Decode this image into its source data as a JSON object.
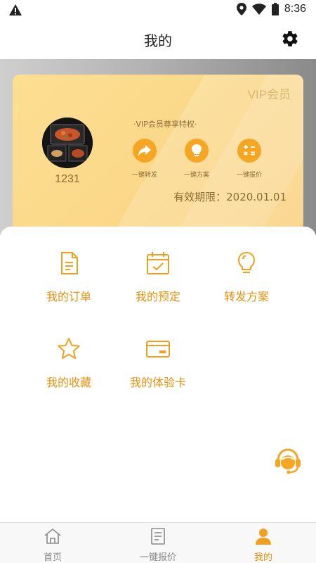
{
  "status_bar": {
    "time": "8:36"
  },
  "header": {
    "title": "我的"
  },
  "vip_card": {
    "badge": "VIP会员",
    "username": "1231",
    "perks_title": "·VIP会员尊享特权·",
    "perks": [
      {
        "label": "一键转发",
        "icon": "share-arrow-icon"
      },
      {
        "label": "一键方案",
        "icon": "lightbulb-icon"
      },
      {
        "label": "一键报价",
        "icon": "calculator-icon"
      }
    ],
    "expiry": "有效期限：2020.01.01"
  },
  "menu": [
    {
      "label": "我的订单",
      "icon": "order-document-icon"
    },
    {
      "label": "我的预定",
      "icon": "calendar-check-icon"
    },
    {
      "label": "转发方案",
      "icon": "lightbulb-icon"
    },
    {
      "label": "我的收藏",
      "icon": "star-icon"
    },
    {
      "label": "我的体验卡",
      "icon": "card-icon"
    }
  ],
  "bottom_nav": [
    {
      "label": "首页",
      "icon": "home-icon",
      "active": false
    },
    {
      "label": "一键报价",
      "icon": "quote-list-icon",
      "active": false
    },
    {
      "label": "我的",
      "icon": "person-icon",
      "active": true
    }
  ],
  "colors": {
    "accent": "#f5a623",
    "accent_text": "#e5920f",
    "card_text": "#8d6c35"
  }
}
